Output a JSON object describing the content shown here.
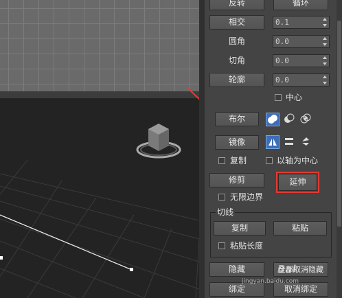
{
  "panel": {
    "row_top": {
      "left_label": "反转",
      "right_label": "循环"
    },
    "spinners": [
      {
        "label": "相交",
        "value": "0.1"
      },
      {
        "label": "圆角",
        "value": "0.0"
      },
      {
        "label": "切角",
        "value": "0.0"
      },
      {
        "label": "轮廓",
        "value": "0.0"
      }
    ],
    "center_checkbox": {
      "label": "中心",
      "checked": false
    },
    "boolean": {
      "label": "布尔"
    },
    "mirror": {
      "label": "镜像"
    },
    "copy_checkbox": {
      "label": "复制",
      "checked": false
    },
    "about_pivot_checkbox": {
      "label": "以轴为中心",
      "checked": false
    },
    "trim": {
      "label": "修剪"
    },
    "extend": {
      "label": "延伸"
    },
    "infinite_bounds_checkbox": {
      "label": "无限边界",
      "checked": false
    },
    "tangent_group": {
      "title": "切线",
      "copy": "复制",
      "paste": "粘贴",
      "paste_length": "粘贴长度"
    },
    "hide": {
      "label": "隐藏"
    },
    "unhide_all": {
      "label": "全部取消隐藏"
    },
    "bind": {
      "label": "绑定"
    },
    "unbind": {
      "label": "取消绑定"
    }
  },
  "watermark": {
    "site": "jingyan.baidu.com",
    "brand": "Bai"
  },
  "colors": {
    "panel_bg": "#444444",
    "viewport_top_bg": "#6a6a6a",
    "viewport_persp_bg": "#232323",
    "active_tool": "#3d6fb8",
    "highlight": "#e23a32",
    "arrow": "#e23a32"
  }
}
